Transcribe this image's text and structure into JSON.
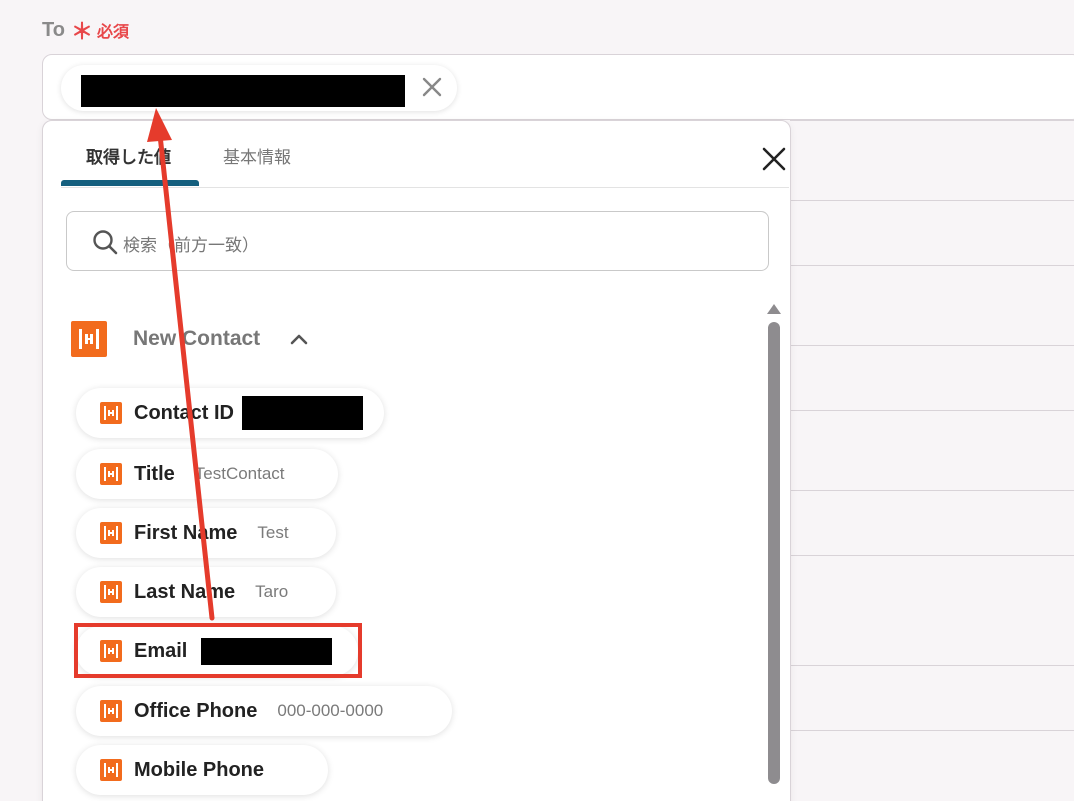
{
  "field": {
    "label": "To",
    "required_star": "＊",
    "required_text": "必須"
  },
  "recipient_chip": {
    "value_redacted": true,
    "remove_icon": "close-icon"
  },
  "picker": {
    "tabs": [
      {
        "label": "取得した値",
        "active": true
      },
      {
        "label": "基本情報",
        "active": false
      }
    ],
    "close_icon": "close-icon",
    "search": {
      "placeholder": "検索（前方一致）",
      "icon": "search-icon"
    },
    "group": {
      "title": "New Contact",
      "expanded": true,
      "icon": "app-logo-icon"
    },
    "items": [
      {
        "label": "Contact ID",
        "value": "",
        "redacted": true
      },
      {
        "label": "Title",
        "value": "TestContact"
      },
      {
        "label": "First Name",
        "value": "Test"
      },
      {
        "label": "Last Name",
        "value": "Taro"
      },
      {
        "label": "Email",
        "value": "",
        "redacted": true,
        "highlighted": true
      },
      {
        "label": "Office Phone",
        "value": "000-000-0000"
      },
      {
        "label": "Mobile Phone",
        "value": ""
      }
    ]
  },
  "colors": {
    "accent_tab": "#145f7e",
    "app_brand": "#f26b1d",
    "required": "#e8474a",
    "annotation": "#e53b2c"
  }
}
